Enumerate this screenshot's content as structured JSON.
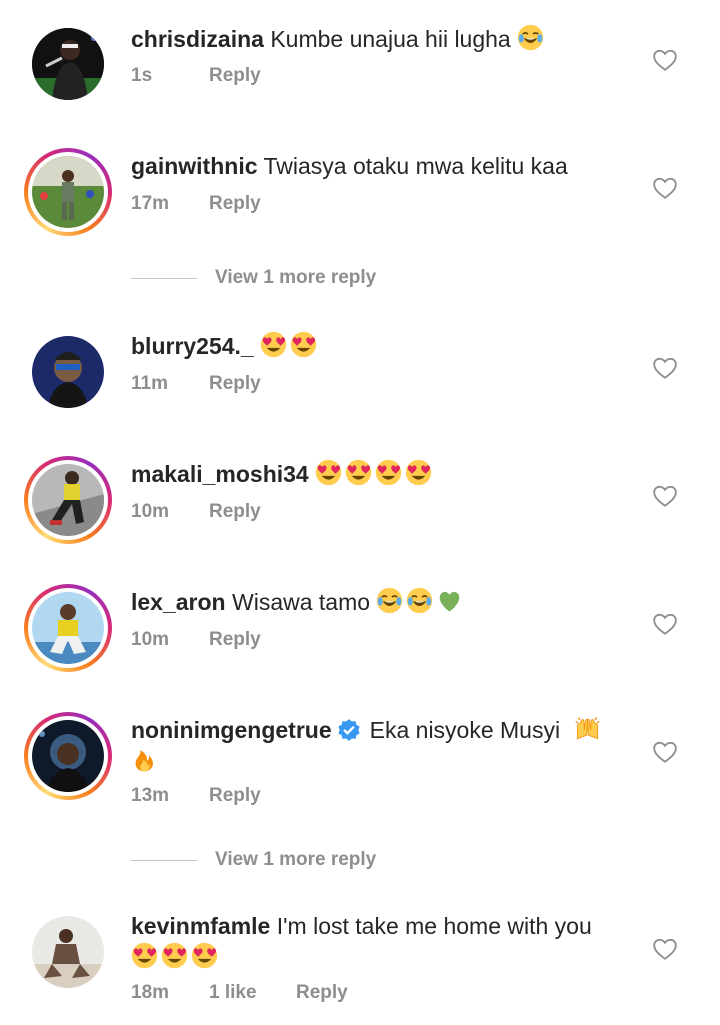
{
  "comments": [
    {
      "username": "chrisdizaina",
      "text": "Kumbe unajua hii lugha",
      "emojis": [
        "joy"
      ],
      "time": "1s",
      "reply_label": "Reply",
      "story_ring": false
    },
    {
      "username": "gainwithnic",
      "text": "Twiasya otaku mwa kelitu kaa",
      "emojis": [],
      "time": "17m",
      "reply_label": "Reply",
      "story_ring": true,
      "view_more": "View 1 more reply"
    },
    {
      "username": "blurry254._",
      "text": "",
      "emojis": [
        "heart-eyes",
        "heart-eyes"
      ],
      "time": "11m",
      "reply_label": "Reply",
      "story_ring": false
    },
    {
      "username": "makali_moshi34",
      "text": "",
      "emojis": [
        "heart-eyes",
        "heart-eyes",
        "heart-eyes",
        "heart-eyes"
      ],
      "time": "10m",
      "reply_label": "Reply",
      "story_ring": true
    },
    {
      "username": "lex_aron",
      "text": "Wisawa tamo",
      "emojis": [
        "joy",
        "joy",
        "green-heart"
      ],
      "time": "10m",
      "reply_label": "Reply",
      "story_ring": true
    },
    {
      "username": "noninimgengetrue",
      "verified": true,
      "text": "Eka nisyoke Musyi",
      "emojis": [
        "raised-hands",
        "fire"
      ],
      "time": "13m",
      "reply_label": "Reply",
      "story_ring": true,
      "view_more": "View 1 more reply"
    },
    {
      "username": "kevinmfamle",
      "text": "I'm lost take me home with you",
      "emojis": [
        "heart-eyes",
        "heart-eyes",
        "heart-eyes"
      ],
      "time": "18m",
      "likes": "1 like",
      "reply_label": "Reply",
      "story_ring": false
    }
  ],
  "colors": {
    "text": "#262626",
    "secondary": "#8e8e8e",
    "verified": "#3897f0"
  },
  "icons": {
    "like": "heart-outline-icon",
    "verified": "verified-badge-icon"
  }
}
